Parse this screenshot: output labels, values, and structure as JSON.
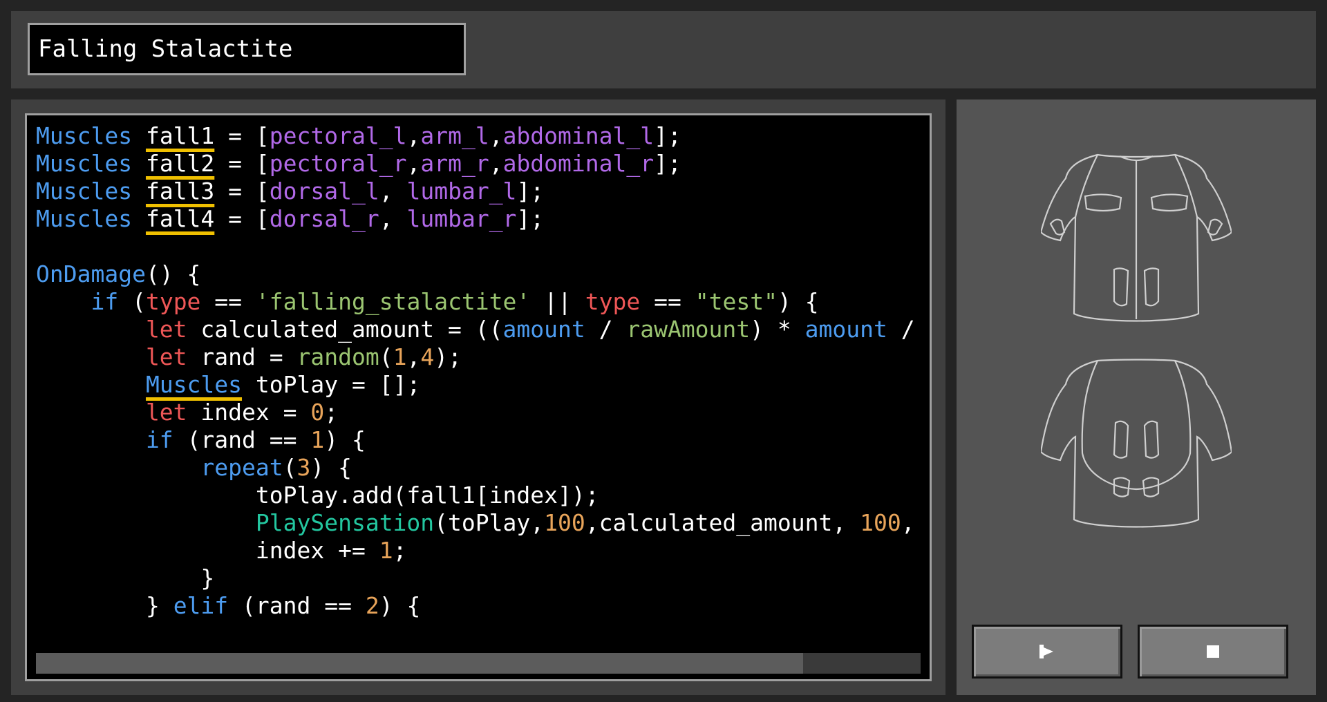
{
  "effect_name": "Falling Stalactite",
  "code_lines": [
    [
      [
        "Muscles ",
        "kw"
      ],
      [
        "fall1",
        "wh ul"
      ],
      [
        " = [",
        "wh"
      ],
      [
        "pectoral_l",
        "pu"
      ],
      [
        ",",
        "wh"
      ],
      [
        "arm_l",
        "pu"
      ],
      [
        ",",
        "wh"
      ],
      [
        "abdominal_l",
        "pu"
      ],
      [
        "];",
        "wh"
      ]
    ],
    [
      [
        "Muscles ",
        "kw"
      ],
      [
        "fall2",
        "wh ul"
      ],
      [
        " = [",
        "wh"
      ],
      [
        "pectoral_r",
        "pu"
      ],
      [
        ",",
        "wh"
      ],
      [
        "arm_r",
        "pu"
      ],
      [
        ",",
        "wh"
      ],
      [
        "abdominal_r",
        "pu"
      ],
      [
        "];",
        "wh"
      ]
    ],
    [
      [
        "Muscles ",
        "kw"
      ],
      [
        "fall3",
        "wh ul"
      ],
      [
        " = [",
        "wh"
      ],
      [
        "dorsal_l",
        "pu"
      ],
      [
        ", ",
        "wh"
      ],
      [
        "lumbar_l",
        "pu"
      ],
      [
        "];",
        "wh"
      ]
    ],
    [
      [
        "Muscles ",
        "kw"
      ],
      [
        "fall4",
        "wh ul"
      ],
      [
        " = [",
        "wh"
      ],
      [
        "dorsal_r",
        "pu"
      ],
      [
        ", ",
        "wh"
      ],
      [
        "lumbar_r",
        "pu"
      ],
      [
        "];",
        "wh"
      ]
    ],
    [],
    [
      [
        "OnDamage",
        "kw"
      ],
      [
        "() {",
        "wh"
      ]
    ],
    [
      [
        "    if ",
        "kw"
      ],
      [
        "(",
        "wh"
      ],
      [
        "type",
        "rd"
      ],
      [
        " == ",
        "wh"
      ],
      [
        "'falling_stalactite'",
        "gr"
      ],
      [
        " || ",
        "wh"
      ],
      [
        "type",
        "rd"
      ],
      [
        " == ",
        "wh"
      ],
      [
        "\"test\"",
        "gr"
      ],
      [
        ") {",
        "wh"
      ]
    ],
    [
      [
        "        let ",
        "rd"
      ],
      [
        "calculated_amount = ((",
        "wh"
      ],
      [
        "amount",
        "kw"
      ],
      [
        " / ",
        "wh"
      ],
      [
        "rawAmount",
        "gr"
      ],
      [
        ") * ",
        "wh"
      ],
      [
        "amount",
        "kw"
      ],
      [
        " / ",
        "wh"
      ]
    ],
    [
      [
        "        let ",
        "rd"
      ],
      [
        "rand = ",
        "wh"
      ],
      [
        "random",
        "gr"
      ],
      [
        "(",
        "wh"
      ],
      [
        "1",
        "nm"
      ],
      [
        ",",
        "wh"
      ],
      [
        "4",
        "nm"
      ],
      [
        ");",
        "wh"
      ]
    ],
    [
      [
        "        ",
        "wh"
      ],
      [
        "Muscles",
        "kw ul"
      ],
      [
        " toPlay = [];",
        "wh"
      ]
    ],
    [
      [
        "        let ",
        "rd"
      ],
      [
        "index = ",
        "wh"
      ],
      [
        "0",
        "nm"
      ],
      [
        ";",
        "wh"
      ]
    ],
    [
      [
        "        if ",
        "kw"
      ],
      [
        "(rand == ",
        "wh"
      ],
      [
        "1",
        "nm"
      ],
      [
        ") {",
        "wh"
      ]
    ],
    [
      [
        "            repeat",
        "kw"
      ],
      [
        "(",
        "wh"
      ],
      [
        "3",
        "nm"
      ],
      [
        ") {",
        "wh"
      ]
    ],
    [
      [
        "                toPlay.add(fall1[index]);",
        "wh"
      ]
    ],
    [
      [
        "                PlaySensation",
        "sg"
      ],
      [
        "(toPlay,",
        "wh"
      ],
      [
        "100",
        "nm"
      ],
      [
        ",calculated_amount, ",
        "wh"
      ],
      [
        "100",
        "nm"
      ],
      [
        ", ",
        "wh"
      ],
      [
        "0",
        "nm"
      ],
      [
        ",",
        "wh"
      ]
    ],
    [
      [
        "                index += ",
        "wh"
      ],
      [
        "1",
        "nm"
      ],
      [
        ";",
        "wh"
      ]
    ],
    [
      [
        "            }",
        "wh"
      ]
    ],
    [
      [
        "        } ",
        "wh"
      ],
      [
        "elif ",
        "kw"
      ],
      [
        "(rand == ",
        "wh"
      ],
      [
        "2",
        "nm"
      ],
      [
        ") {",
        "wh"
      ]
    ]
  ],
  "icons": {
    "play": "play-icon",
    "stop": "stop-icon",
    "suit_front": "suit-front-icon",
    "suit_back": "suit-back-icon"
  }
}
